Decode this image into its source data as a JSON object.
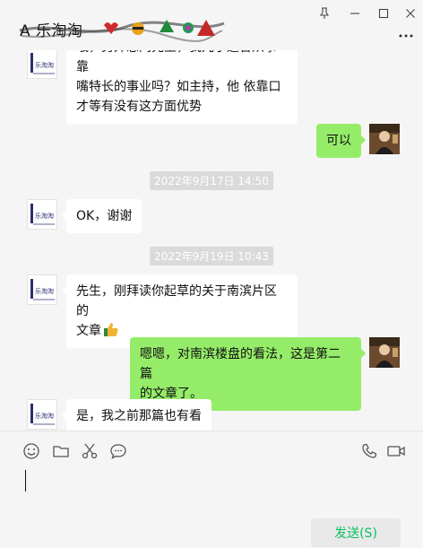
{
  "window": {
    "title": "A 乐淘淘",
    "controls": {
      "pin_icon": "pin-icon",
      "minimize_icon": "minimize-icon",
      "maximize_icon": "maximize-icon",
      "close_icon": "close-icon",
      "more_icon": "more-icon"
    }
  },
  "chat": {
    "messages": [
      {
        "side": "left",
        "text_line1": "哦，另外想问先生，我儿子适合从事靠",
        "text_line2": "嘴特长的事业吗？如主持，他 依靠口",
        "text_line3": "才等有没有这方面优势"
      },
      {
        "side": "right",
        "text": "可以"
      },
      {
        "type": "time",
        "text": "2022年9月17日 14:50"
      },
      {
        "side": "left",
        "text": "OK，谢谢"
      },
      {
        "type": "time",
        "text": "2022年9月19日 10:43"
      },
      {
        "side": "left",
        "text_line1": "先生，刚拜读你起草的关于南滨片区的",
        "text_line2": "文章",
        "emoji": "thumbs-up"
      },
      {
        "side": "right",
        "text_line1": "嗯嗯，对南滨楼盘的看法，这是第二篇",
        "text_line2": "的文章了。"
      },
      {
        "side": "left",
        "text": "是，我之前那篇也有看"
      }
    ]
  },
  "toolbar": {
    "left_tools": [
      "emoji-icon",
      "folder-icon",
      "scissors-icon",
      "chat-bubble-icon"
    ],
    "right_tools": [
      "phone-icon",
      "video-icon"
    ]
  },
  "composer": {
    "value": ""
  },
  "send_button": {
    "label": "发送(S)"
  },
  "colors": {
    "sent_bubble": "#95ec69",
    "received_bubble": "#ffffff",
    "send_text": "#07c160",
    "background": "#f5f5f5"
  }
}
